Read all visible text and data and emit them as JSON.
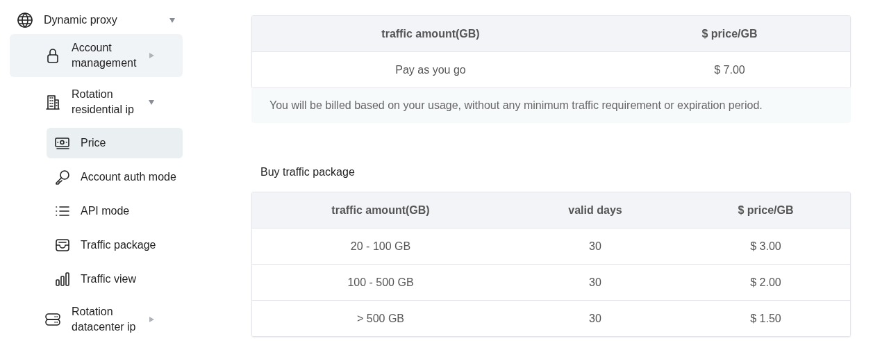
{
  "sidebar": {
    "items": [
      {
        "label": "Dynamic proxy",
        "expanded": true,
        "selected": false,
        "children": [
          {
            "label": "Account management",
            "expanded": false,
            "selected": true
          },
          {
            "label": "Rotation residential ip",
            "expanded": true,
            "selected": false,
            "children": [
              {
                "label": "Price",
                "selected": true
              },
              {
                "label": "Account auth mode",
                "selected": false
              },
              {
                "label": "API mode",
                "selected": false
              },
              {
                "label": "Traffic package",
                "selected": false
              },
              {
                "label": "Traffic view",
                "selected": false
              }
            ]
          },
          {
            "label": "Rotation datacenter ip",
            "expanded": false,
            "selected": false
          }
        ]
      }
    ]
  },
  "sections": [
    {
      "table": {
        "columns": [
          "traffic amount(GB)",
          "$ price/GB"
        ],
        "rows": [
          [
            "Pay as you go",
            "$ 7.00"
          ]
        ]
      },
      "note": "You will be billed based on your usage, without any minimum traffic requirement or expiration period."
    },
    {
      "title": "Buy traffic package",
      "table": {
        "columns": [
          "traffic amount(GB)",
          "valid days",
          "$ price/GB"
        ],
        "rows": [
          [
            "20 - 100 GB",
            "30",
            "$ 3.00"
          ],
          [
            "100 - 500 GB",
            "30",
            "$ 2.00"
          ],
          [
            "> 500 GB",
            "30",
            "$ 1.50"
          ]
        ]
      }
    }
  ]
}
